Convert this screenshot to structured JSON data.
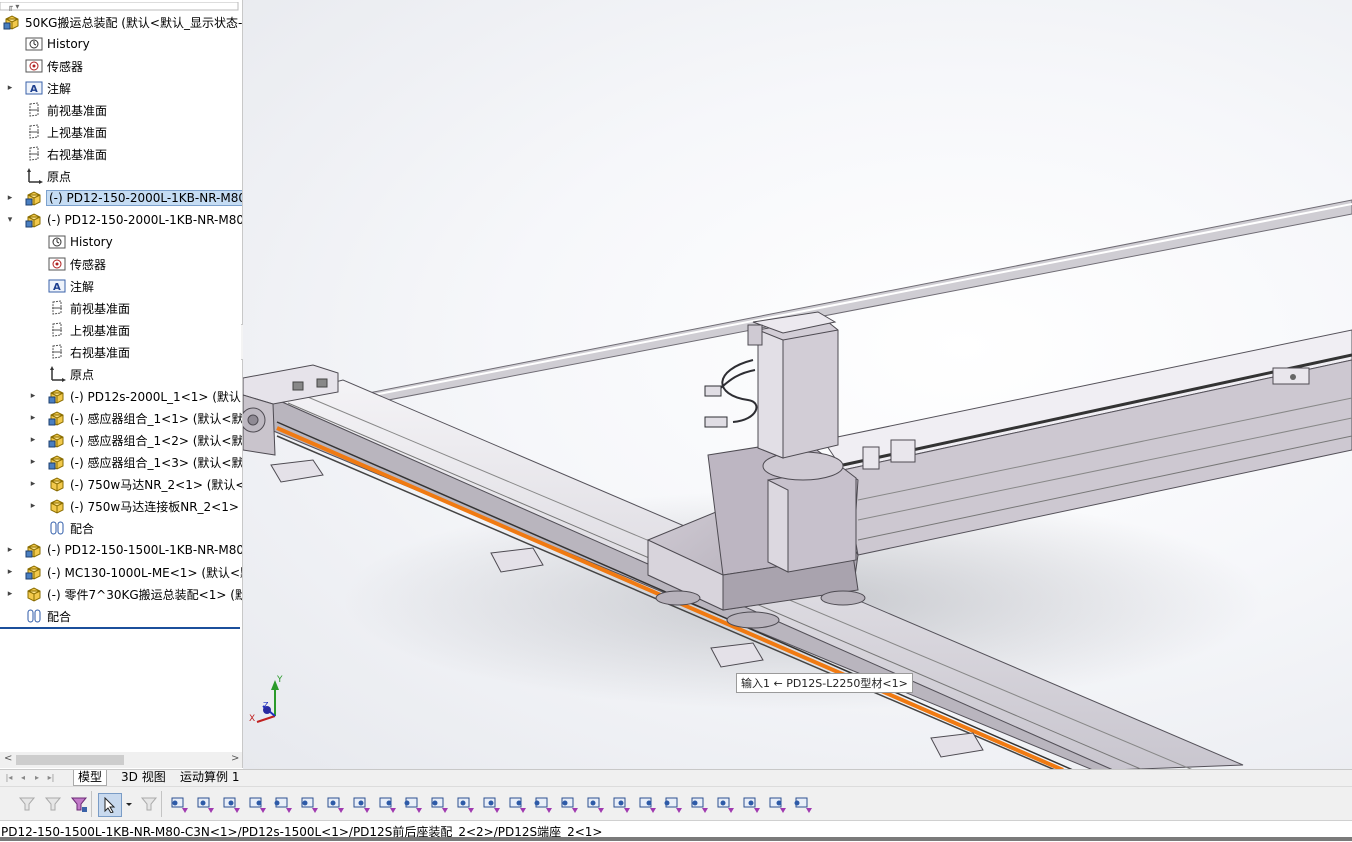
{
  "tree": {
    "root_label": "50KG搬运总装配  (默认<默认_显示状态-",
    "items": [
      {
        "label": "History",
        "icon": "history-icon",
        "indent": 0,
        "expander": ""
      },
      {
        "label": "传感器",
        "icon": "sensor-icon",
        "indent": 0,
        "expander": ""
      },
      {
        "label": "注解",
        "icon": "annotation-icon",
        "indent": 0,
        "expander": "▸"
      },
      {
        "label": "前视基准面",
        "icon": "plane-icon",
        "indent": 0,
        "expander": ""
      },
      {
        "label": "上视基准面",
        "icon": "plane-icon",
        "indent": 0,
        "expander": ""
      },
      {
        "label": "右视基准面",
        "icon": "plane-icon",
        "indent": 0,
        "expander": ""
      },
      {
        "label": "原点",
        "icon": "origin-icon",
        "indent": 0,
        "expander": ""
      },
      {
        "label": "(-) PD12-150-2000L-1KB-NR-M80",
        "icon": "assembly-icon",
        "indent": 0,
        "expander": "▸"
      },
      {
        "label": "(-) PD12-150-2000L-1KB-NR-M80",
        "icon": "assembly-icon",
        "indent": 0,
        "expander": "▾"
      },
      {
        "label": "History",
        "icon": "history-icon",
        "indent": 1,
        "expander": ""
      },
      {
        "label": "传感器",
        "icon": "sensor-icon",
        "indent": 1,
        "expander": ""
      },
      {
        "label": "注解",
        "icon": "annotation-icon",
        "indent": 1,
        "expander": ""
      },
      {
        "label": "前视基准面",
        "icon": "plane-icon",
        "indent": 1,
        "expander": ""
      },
      {
        "label": "上视基准面",
        "icon": "plane-icon",
        "indent": 1,
        "expander": ""
      },
      {
        "label": "右视基准面",
        "icon": "plane-icon",
        "indent": 1,
        "expander": ""
      },
      {
        "label": "原点",
        "icon": "origin-icon",
        "indent": 1,
        "expander": ""
      },
      {
        "label": "(-) PD12s-2000L_1<1> (默认<",
        "icon": "assembly-icon",
        "indent": 1,
        "expander": "▸"
      },
      {
        "label": "(-) 感应器组合_1<1> (默认<默",
        "icon": "assembly-icon",
        "indent": 1,
        "expander": "▸"
      },
      {
        "label": "(-) 感应器组合_1<2> (默认<默",
        "icon": "assembly-icon",
        "indent": 1,
        "expander": "▸"
      },
      {
        "label": "(-) 感应器组合_1<3> (默认<默",
        "icon": "assembly-icon",
        "indent": 1,
        "expander": "▸"
      },
      {
        "label": "(-) 750w马达NR_2<1> (默认<",
        "icon": "part-icon",
        "indent": 1,
        "expander": "▸"
      },
      {
        "label": "(-) 750w马达连接板NR_2<1> (",
        "icon": "part-icon",
        "indent": 1,
        "expander": "▸"
      },
      {
        "label": "配合",
        "icon": "mate-icon",
        "indent": 1,
        "expander": ""
      },
      {
        "label": "(-) PD12-150-1500L-1KB-NR-M80",
        "icon": "assembly-icon",
        "indent": 0,
        "expander": "▸"
      },
      {
        "label": "(-) MC130-1000L-ME<1> (默认<默",
        "icon": "assembly-icon",
        "indent": 0,
        "expander": "▸"
      },
      {
        "label": "(-) 零件7^30KG搬运总装配<1> (默",
        "icon": "part-icon",
        "indent": 0,
        "expander": "▸"
      },
      {
        "label": "配合",
        "icon": "mate-icon",
        "indent": 0,
        "expander": ""
      }
    ]
  },
  "viewport": {
    "tooltip": "输入1 ← PD12S-L2250型材<1>",
    "triad": {
      "x": "X",
      "y": "Y",
      "z": "Z"
    }
  },
  "tabs": {
    "items": [
      "模型",
      "3D 视图",
      "运动算例 1"
    ],
    "active": "模型"
  },
  "toolbar": {
    "icons": [
      "filter-icon",
      "filter-icon",
      "filter-toolbar-icon",
      "select-arrow-icon",
      "dropdown-icon",
      "select-other-icon",
      "filter-vertices-icon",
      "filter-edges-icon",
      "filter-faces-icon",
      "filter-surface-bodies-icon",
      "filter-solid-bodies-icon",
      "filter-axes-icon",
      "filter-planes-icon",
      "filter-sketch-points-icon",
      "filter-sketch-segments-icon",
      "filter-midpoints-icon",
      "filter-center-marks-icon",
      "filter-centerline-icon",
      "filter-dimensions-icon",
      "filter-surface-finish-icon",
      "filter-geometric-tolerance-icon",
      "filter-notes-icon",
      "filter-datum-feature-icon",
      "filter-weld-symbol-icon",
      "filter-datum-target-icon",
      "filter-cosmetic-threads-icon",
      "filter-blocks-icon",
      "filter-dowel-pin-icon",
      "filter-connection-points-icon",
      "filter-routing-points-icon",
      "filter-mesh-icon"
    ],
    "active_index": 3
  },
  "status": {
    "path": "PD12-150-1500L-1KB-NR-M80-C3N<1>/PD12s-1500L<1>/PD12S前后座装配_2<2>/PD12S端座_2<1>"
  },
  "colors": {
    "selection_blue": "#c5dcf3",
    "tree_end_line": "#1b4f9b",
    "belt_orange": "#f07a12",
    "machine_gray": "#c9c4cc"
  }
}
